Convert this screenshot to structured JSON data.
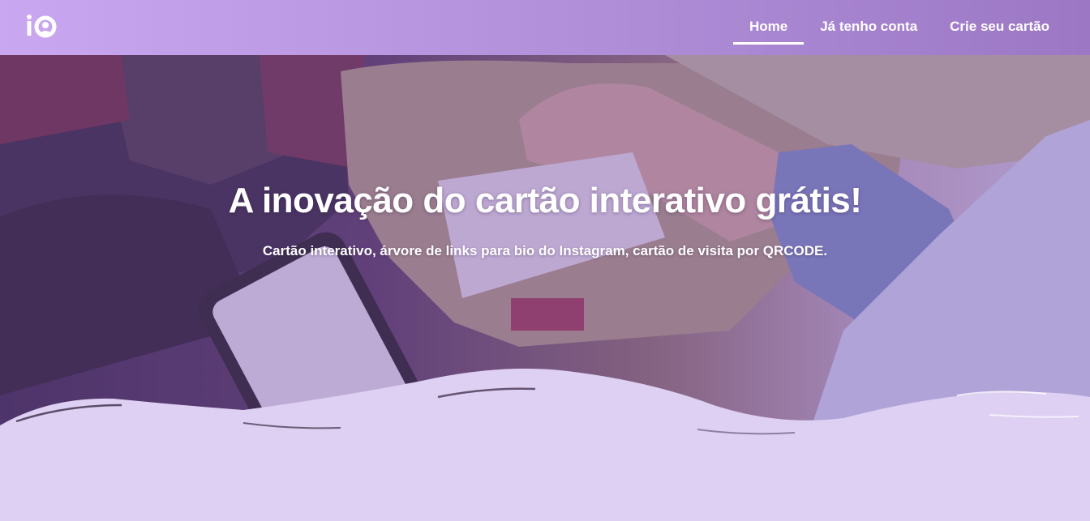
{
  "nav": {
    "items": [
      {
        "label": "Home",
        "active": true
      },
      {
        "label": "Já tenho conta",
        "active": false
      },
      {
        "label": "Crie seu cartão",
        "active": false
      }
    ]
  },
  "hero": {
    "headline": "A inovação do cartão interativo grátis!",
    "subline": "Cartão interativo, árvore de links para bio do Instagram, cartão de visita por QRCODE."
  },
  "colors": {
    "navbar_start": "#c9a7f1",
    "navbar_end": "#9c78c4",
    "wave_fill": "#ddd0f2",
    "text": "#ffffff"
  },
  "icons": {
    "logo": "logo-icon"
  }
}
